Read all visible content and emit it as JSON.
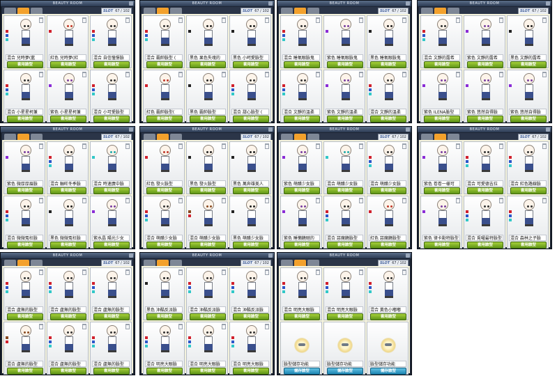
{
  "window_title": "BEAUTY ROOM",
  "slot_label": "SLOT",
  "slot_count": "67 / 102",
  "button_label": "套用臉型",
  "save_button_label": "儲存臉型",
  "colors": {
    "black": "#222222",
    "red": "#d1202c",
    "blue": "#2b56c9",
    "green": "#2e8f2e",
    "yellow": "#e6b81e",
    "purple": "#8a2bd6",
    "pink": "#e07ab5",
    "brown": "#8a4a20",
    "cyan": "#30c8c8",
    "amber": "#e08a20"
  },
  "panels": [
    {
      "cards": [
        {
          "name": "混合 兒時夢(藍",
          "dots": [
            "red",
            "blue",
            "cyan"
          ],
          "eye": "#333"
        },
        {
          "name": "紅色 兒時夢(紅",
          "dots": [
            "red"
          ],
          "eye": "#c0392b"
        },
        {
          "name": "混合 自信憧憬臉",
          "dots": [
            "red",
            "blue",
            "cyan"
          ],
          "eye": "#333"
        },
        {
          "name": "混合 小星星柯兼",
          "dots": [
            "red",
            "blue",
            "cyan"
          ],
          "eye": "#333"
        },
        {
          "name": "紫色 小星星柯兼",
          "dots": [
            "purple"
          ],
          "eye": "#7a3fa0"
        },
        {
          "name": "混合 小可愛臉型",
          "dots": [
            "red",
            "blue",
            "cyan"
          ],
          "eye": "#333"
        }
      ]
    },
    {
      "cards": [
        {
          "name": "混合 霸帥臉型 (",
          "dots": [
            "red",
            "blue",
            "cyan"
          ],
          "eye": "#333"
        },
        {
          "name": "黑色 果色失魂的",
          "dots": [
            "black"
          ],
          "eye": "#222"
        },
        {
          "name": "黑色 小呵愛臉型",
          "dots": [
            "black"
          ],
          "eye": "#222"
        },
        {
          "name": "紅色 霸帥臉型(",
          "dots": [
            "red"
          ],
          "eye": "#c0392b"
        },
        {
          "name": "黑色 霸帥臉型",
          "dots": [
            "black"
          ],
          "eye": "#222"
        },
        {
          "name": "混合 甜心臉型 (",
          "dots": [
            "red",
            "blue",
            "cyan"
          ],
          "eye": "#333"
        }
      ]
    },
    {
      "cards": [
        {
          "name": "混合 睡氧眼臉鬼",
          "dots": [
            "red",
            "blue",
            "cyan"
          ],
          "eye": "#333"
        },
        {
          "name": "紫色 睡氧眼臉鬼",
          "dots": [
            "purple"
          ],
          "eye": "#7a3fa0"
        },
        {
          "name": "黑色 睡氧眼臉鬼",
          "dots": [
            "black"
          ],
          "eye": "#222"
        },
        {
          "name": "混合 文靜的溫柔",
          "dots": [
            "red",
            "blue",
            "cyan"
          ],
          "eye": "#333"
        },
        {
          "name": "紫色 文靜的溫柔",
          "dots": [
            "purple"
          ],
          "eye": "#7a3fa0"
        },
        {
          "name": "混合 文靜的溫柔",
          "dots": [
            "red",
            "blue",
            "cyan"
          ],
          "eye": "#333"
        }
      ]
    },
    {
      "cards": [
        {
          "name": "混合 文靜的露希",
          "dots": [
            "red",
            "blue",
            "cyan"
          ],
          "eye": "#333"
        },
        {
          "name": "紫色 文靜的露希",
          "dots": [
            "purple"
          ],
          "eye": "#7a3fa0"
        },
        {
          "name": "黑色 文靜的露希",
          "dots": [
            "black"
          ],
          "eye": "#222"
        },
        {
          "name": "紫色 ILENA臉型",
          "dots": [
            "purple"
          ],
          "eye": "#7a3fa0"
        },
        {
          "name": "紫色 悠然自得臉",
          "dots": [
            "purple"
          ],
          "eye": "#7a3fa0"
        },
        {
          "name": "紫色 悠然自得臉",
          "dots": [
            "purple"
          ],
          "eye": "#7a3fa0"
        }
      ]
    },
    {
      "cards": [
        {
          "name": "紫色 微厚厚眉臉",
          "dots": [
            "purple"
          ],
          "eye": "#7a3fa0"
        },
        {
          "name": "混合 軸旺冬季臉",
          "dots": [
            "red",
            "blue",
            "cyan"
          ],
          "eye": "#333"
        },
        {
          "name": "混合 時速廣中臉",
          "dots": [
            "cyan"
          ],
          "eye": "#2aa"
        },
        {
          "name": "混合 微微冤枉臉",
          "dots": [
            "red",
            "blue",
            "cyan"
          ],
          "eye": "#333"
        },
        {
          "name": "黑色 微微冤枉臉",
          "dots": [
            "black"
          ],
          "eye": "#222"
        },
        {
          "name": "紫水晶 陽光少女",
          "dots": [
            "purple"
          ],
          "eye": "#7a3fa0"
        }
      ]
    },
    {
      "cards": [
        {
          "name": "紅色 發火臉型",
          "dots": [
            "red"
          ],
          "eye": "#c0392b"
        },
        {
          "name": "黑色 發火臉型",
          "dots": [
            "black"
          ],
          "eye": "#222"
        },
        {
          "name": "黑色 萬奔雄美人",
          "dots": [
            "black"
          ],
          "eye": "#222"
        },
        {
          "name": "混合 萌醋少女臉",
          "dots": [
            "red",
            "blue",
            "cyan"
          ],
          "eye": "#333"
        },
        {
          "name": "混合 萌醋少女臉",
          "dots": [
            "brown",
            "red"
          ],
          "eye": "#8a4a20"
        },
        {
          "name": "黑色 萌醋少女臉",
          "dots": [
            "black"
          ],
          "eye": "#222"
        }
      ]
    },
    {
      "cards": [
        {
          "name": "紫色 萌醋少女臉",
          "dots": [
            "purple"
          ],
          "eye": "#7a3fa0"
        },
        {
          "name": "混合 萌醋少女臉",
          "dots": [
            "cyan"
          ],
          "eye": "#2aa"
        },
        {
          "name": "混合 萌醋少女臉",
          "dots": [
            "red",
            "blue",
            "cyan"
          ],
          "eye": "#333"
        },
        {
          "name": "紫色 睡懶饒瞇的",
          "dots": [
            "purple"
          ],
          "eye": "#7a3fa0"
        },
        {
          "name": "混合 惡魔饒臉型",
          "dots": [
            "red",
            "blue",
            "cyan"
          ],
          "eye": "#333"
        },
        {
          "name": "紅色 惡魔饒臉型",
          "dots": [
            "red"
          ],
          "eye": "#c0392b"
        }
      ]
    },
    {
      "cards": [
        {
          "name": "紫色 卷卷一樣可",
          "dots": [
            "purple"
          ],
          "eye": "#7a3fa0"
        },
        {
          "name": "混合 可愛德吉拉",
          "dots": [
            "red",
            "blue",
            "cyan"
          ],
          "eye": "#333"
        },
        {
          "name": "混合 紅色路線臉",
          "dots": [
            "red",
            "blue",
            "cyan"
          ],
          "eye": "#333"
        },
        {
          "name": "紫色 律卡勳特臉型",
          "dots": [
            "purple"
          ],
          "eye": "#7a3fa0"
        },
        {
          "name": "混合 覓曜最特臉型",
          "dots": [
            "red",
            "blue",
            "cyan"
          ],
          "eye": "#333"
        },
        {
          "name": "混合 森林之子臉",
          "dots": [
            "red",
            "blue",
            "cyan"
          ],
          "eye": "#333"
        }
      ]
    },
    {
      "cards": [
        {
          "name": "混合 盧無的臉型",
          "dots": [
            "red",
            "blue",
            "cyan"
          ],
          "eye": "#333"
        },
        {
          "name": "混合 盧無的臉型",
          "dots": [
            "red",
            "blue",
            "cyan"
          ],
          "eye": "#333"
        },
        {
          "name": "混合 盧無的臉型",
          "dots": [
            "red",
            "blue",
            "cyan"
          ],
          "eye": "#333"
        },
        {
          "name": "混合 盧無的臉型",
          "dots": [
            "brown",
            "red"
          ],
          "eye": "#8a4a20"
        },
        {
          "name": "混合 盧無的臉型",
          "dots": [
            "red",
            "blue",
            "cyan"
          ],
          "eye": "#333"
        },
        {
          "name": "混合 盧無的臉型",
          "dots": [
            "red",
            "blue",
            "cyan"
          ],
          "eye": "#333"
        }
      ]
    },
    {
      "cards": [
        {
          "name": "黑色 沖酷反派臉",
          "dots": [
            "black"
          ],
          "eye": "#222"
        },
        {
          "name": "混合 沖酷反派臉",
          "dots": [
            "red",
            "blue",
            "cyan"
          ],
          "eye": "#333"
        },
        {
          "name": "混合 沖酷反派臉",
          "dots": [
            "red",
            "blue",
            "cyan"
          ],
          "eye": "#333"
        },
        {
          "name": "混合 明亮大眼臉",
          "dots": [
            "red",
            "blue",
            "cyan"
          ],
          "eye": "#333"
        },
        {
          "name": "混合 明亮大眼臉",
          "dots": [
            "red",
            "blue",
            "cyan"
          ],
          "eye": "#333"
        },
        {
          "name": "混合 明亮大眼臉",
          "dots": [
            "red",
            "blue",
            "cyan"
          ],
          "eye": "#333"
        }
      ]
    },
    {
      "cards": [
        {
          "name": "混合 明亮大眼臉",
          "dots": [
            "red",
            "blue",
            "cyan"
          ],
          "eye": "#333"
        },
        {
          "name": "混合 明亮大眼臉",
          "dots": [
            "red",
            "blue",
            "cyan"
          ],
          "eye": "#333"
        },
        {
          "name": "混合 黃色小嘟嘟",
          "dots": [
            "red",
            "blue",
            "cyan"
          ],
          "eye": "#333"
        },
        {
          "name": "臉型儲存功能",
          "face": true
        },
        {
          "name": "臉型儲存功能",
          "face": true
        },
        {
          "name": "臉型儲存功能",
          "face": true
        }
      ]
    }
  ]
}
